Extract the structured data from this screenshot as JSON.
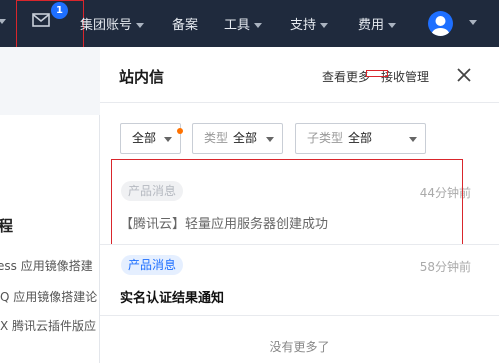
{
  "topnav": {
    "mail_badge": "1",
    "items": [
      {
        "label": "集团账号",
        "has_caret": true
      },
      {
        "label": "备案",
        "has_caret": false
      },
      {
        "label": "工具",
        "has_caret": true
      },
      {
        "label": "支持",
        "has_caret": true
      },
      {
        "label": "费用",
        "has_caret": true
      }
    ],
    "avatar_icon": "user-avatar-icon",
    "colors": {
      "bar": "#1f2a3d",
      "badge": "#1e6fff"
    }
  },
  "left_page": {
    "heading": "程",
    "lines": [
      "ess 应用镜像搭建",
      "Q 应用镜像搭建论",
      "X 腾讯云插件版应"
    ]
  },
  "panel": {
    "title": "站内信",
    "view_more": "查看更多",
    "receive_mgmt": "接收管理",
    "filters": [
      {
        "label": "",
        "value": "全部"
      },
      {
        "label": "类型",
        "value": "全部"
      },
      {
        "label": "子类型",
        "value": "全部"
      }
    ],
    "messages": [
      {
        "tag": "产品消息",
        "time": "44分钟前",
        "title": "【腾讯云】轻量应用服务器创建成功",
        "read": true
      },
      {
        "tag": "产品消息",
        "time": "58分钟前",
        "title": "实名认证结果通知",
        "read": false
      }
    ],
    "no_more": "没有更多了",
    "colors": {
      "highlight": "#d9262c",
      "unread_dot": "#ff7200",
      "tag_unread_bg": "#e5efff",
      "tag_unread_fg": "#1e6fff"
    }
  }
}
